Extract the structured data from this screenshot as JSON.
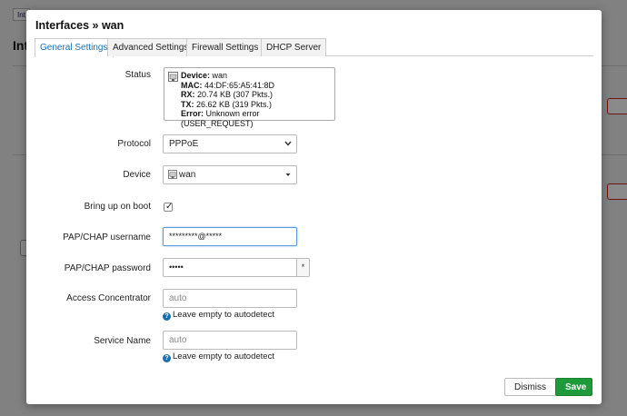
{
  "background": {
    "tab_label": "Int",
    "title": "Int"
  },
  "modal": {
    "title": "Interfaces » wan",
    "tabs": [
      {
        "label": "General Settings",
        "active": true
      },
      {
        "label": "Advanced Settings",
        "active": false
      },
      {
        "label": "Firewall Settings",
        "active": false
      },
      {
        "label": "DHCP Server",
        "active": false
      }
    ],
    "status": {
      "label": "Status",
      "icon": "ethernet-port-icon",
      "device_key": "Device:",
      "device_val": " wan",
      "mac_key": "MAC:",
      "mac_val": " 44:DF:65:A5:41:8D",
      "rx_key": "RX:",
      "rx_val": " 20.74 KB (307 Pkts.)",
      "tx_key": "TX:",
      "tx_val": " 26.62 KB (319 Pkts.)",
      "error_key": "Error:",
      "error_val": " Unknown error (USER_REQUEST)"
    },
    "protocol": {
      "label": "Protocol",
      "value": "PPPoE"
    },
    "device": {
      "label": "Device",
      "value": "wan",
      "icon": "ethernet-port-icon"
    },
    "boot": {
      "label": "Bring up on boot",
      "checked": true,
      "check_glyph": "✓"
    },
    "username": {
      "label": "PAP/CHAP username",
      "value": "*********@*****"
    },
    "password": {
      "label": "PAP/CHAP password",
      "value": "•••••",
      "reveal": "*"
    },
    "concentrator": {
      "label": "Access Concentrator",
      "placeholder": "auto",
      "hint": "Leave empty to autodetect"
    },
    "service": {
      "label": "Service Name",
      "placeholder": "auto",
      "hint": "Leave empty to autodetect"
    },
    "hint_icon": "?",
    "buttons": {
      "dismiss": "Dismiss",
      "save": "Save"
    },
    "colors": {
      "accent": "#1a6fb3",
      "save": "#1f9a3a",
      "danger": "#cc2222"
    }
  }
}
